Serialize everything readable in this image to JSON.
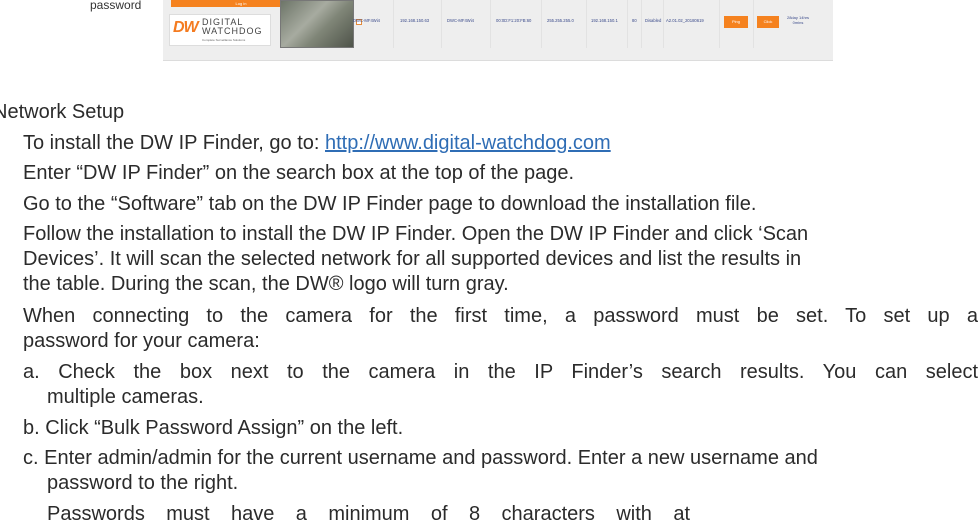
{
  "screenshot": {
    "left_caption": "password",
    "login_button": "Log in",
    "logo_mark": "DW",
    "logo_name_1": "DIGITAL",
    "logo_name_2": "WATCHDOG",
    "logo_tagline": "Complete Surveillance Solutions",
    "row": {
      "model": "DWC-MF4Wi4",
      "ip": "192.168.150.63",
      "name": "DWC-MF4Wi4",
      "mac": "00:0D:F1:20:FB:60",
      "subnet": "255.255.255.0",
      "gateway": "192.168.150.1",
      "port": "80",
      "dhcp": "Disabled",
      "firmware": "A2.01.02_20180619",
      "ping_label": "Ping",
      "click_label": "Click",
      "uptime_1": "28day 14hrs",
      "uptime_2": "0mins"
    }
  },
  "document": {
    "heading": "Network Setup",
    "item1_pre": "To install the DW IP Finder, go to: ",
    "item1_link": "http://www.digital-watchdog.com",
    "item2": "Enter “DW IP Finder” on the search box at the top of the page.",
    "item3": "Go to the “Software” tab on the DW IP Finder page to download the installation file.",
    "item4_l1": "Follow the installation to install the DW IP Finder. Open the DW IP Finder and click ‘Scan",
    "item4_l2": "Devices’. It will scan the selected network for all supported devices and list the results in",
    "item4_l3": "the table. During the scan, the DW® logo will turn gray.",
    "item5_l1": "When connecting to the camera for the first time, a password must be set. To set up a",
    "item5_l2": "password for your camera:",
    "sub_a_l1": "a. Check the box next to the camera in the IP Finder’s search results. You can select",
    "sub_a_l2": "multiple cameras.",
    "sub_b": "b. Click “Bulk Password Assign” on the left.",
    "sub_c_l1": "c. Enter admin/admin for the current username and password. Enter a new username and",
    "sub_c_l2": "password to the right.",
    "note": "Passwords must have a minimum of 8 characters with at",
    "list_marker": "."
  }
}
